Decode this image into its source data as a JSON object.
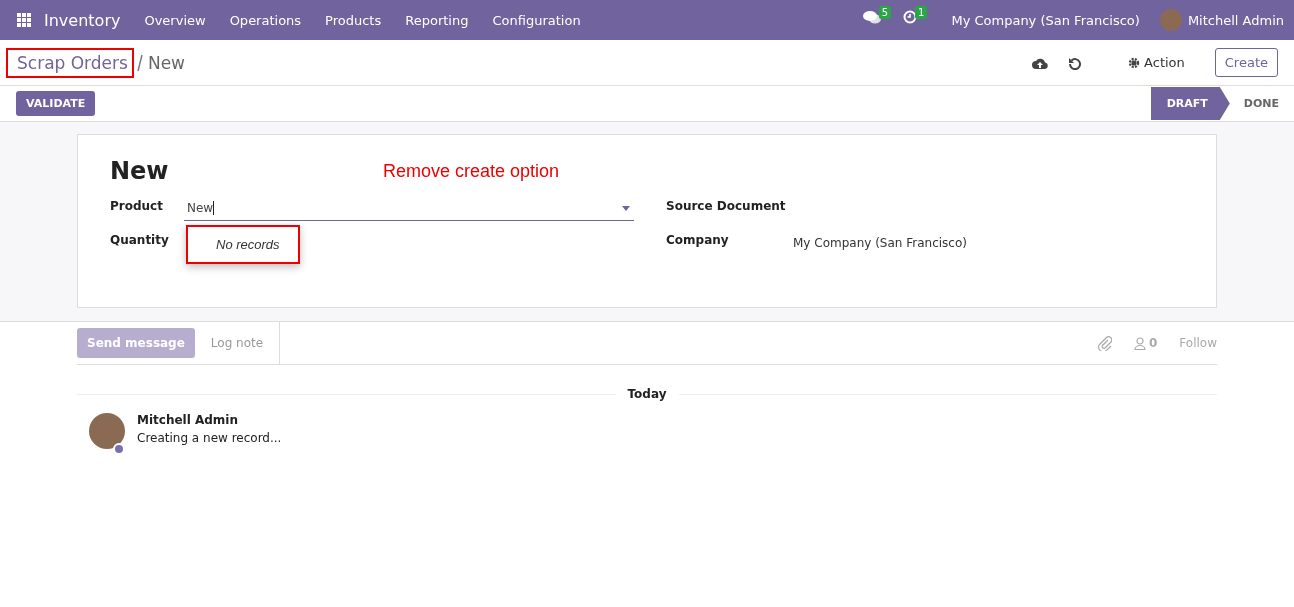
{
  "navbar": {
    "app": "Inventory",
    "menu": [
      "Overview",
      "Operations",
      "Products",
      "Reporting",
      "Configuration"
    ],
    "messages_count": "5",
    "activities_count": "1",
    "company": "My Company (San Francisco)",
    "user": "Mitchell Admin"
  },
  "breadcrumb": {
    "parent": "Scrap Orders",
    "current": "New",
    "parent_highlighted": true
  },
  "toolbar": {
    "action": "Action",
    "create": "Create"
  },
  "validate": "VALIDATE",
  "stages": [
    {
      "label": "DRAFT",
      "selected": true
    },
    {
      "label": "DONE",
      "selected": false
    }
  ],
  "form": {
    "title": "New",
    "annotation": "Remove create option",
    "left": [
      {
        "label": "Product",
        "value": "New",
        "kind": "dropdown"
      },
      {
        "label": "Quantity",
        "kind": "empty"
      }
    ],
    "right": [
      {
        "label": "Source Document"
      },
      {
        "label": "Company",
        "value": "My Company (San Francisco)"
      }
    ],
    "dropdown": {
      "text": "No records",
      "highlighted": true
    }
  },
  "chatter": {
    "send": "Send message",
    "log": "Log note",
    "followers": "0",
    "follow": "Follow",
    "date": "Today",
    "messages": [
      {
        "author": "Mitchell Admin",
        "body": "Creating a new record..."
      }
    ]
  }
}
